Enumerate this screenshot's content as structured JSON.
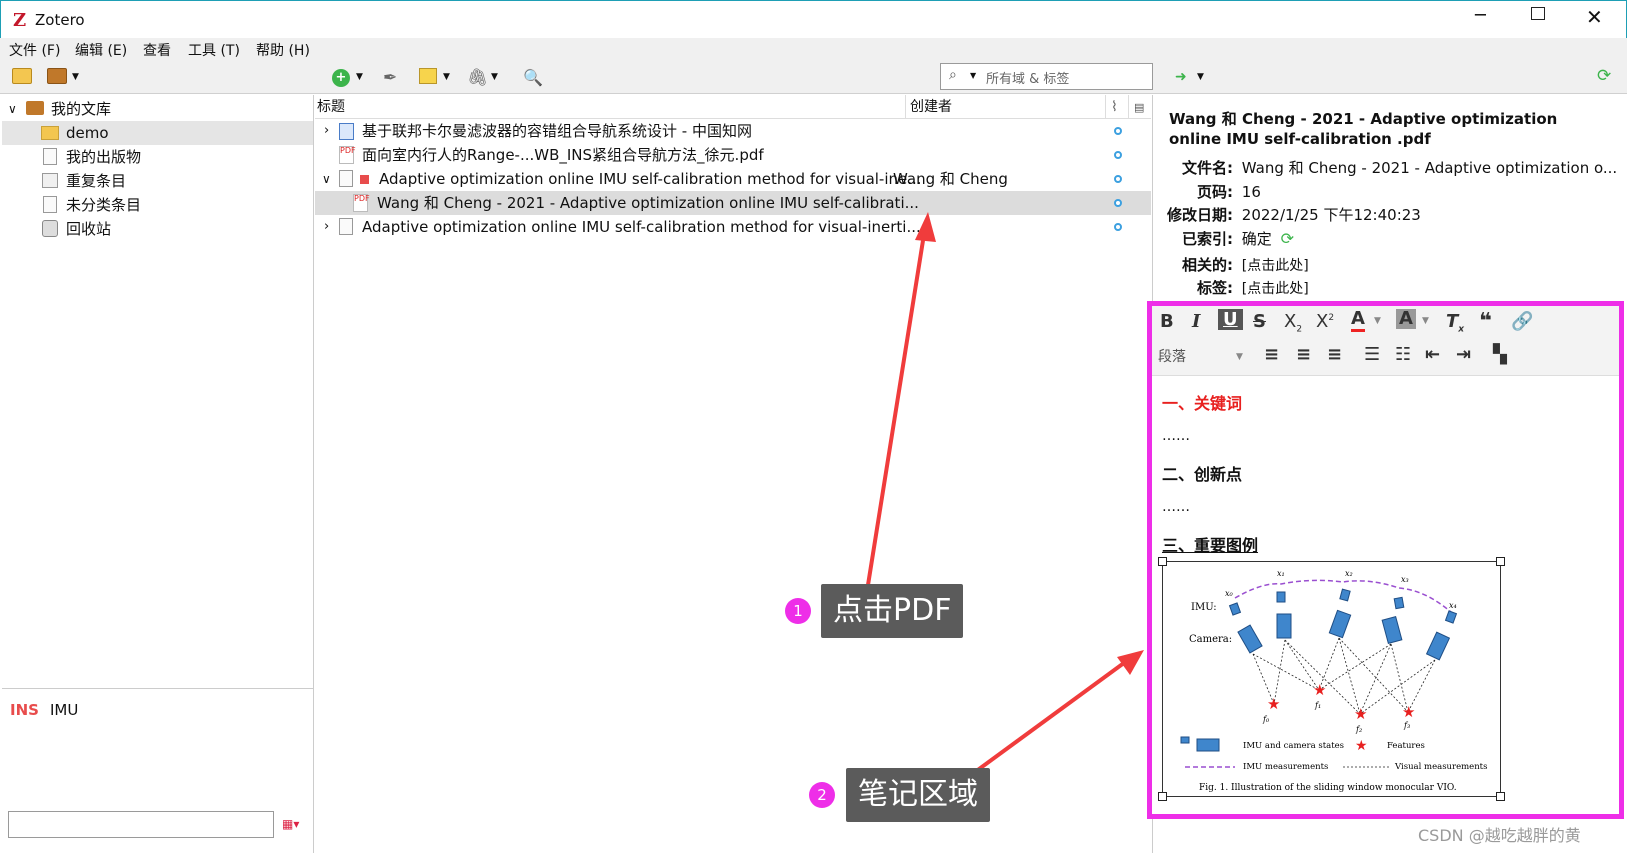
{
  "window": {
    "app_title": "Zotero"
  },
  "menu": [
    "文件 (F)",
    "编辑 (E)",
    "查看",
    "工具 (T)",
    "帮助 (H)"
  ],
  "search": {
    "placeholder": "所有域 & 标签"
  },
  "library": {
    "root": "我的文库",
    "items": [
      "demo",
      "我的出版物",
      "重复条目",
      "未分类条目",
      "回收站"
    ]
  },
  "tags": [
    "INS",
    "IMU"
  ],
  "columns": {
    "title": "标题",
    "creator": "创建者"
  },
  "items": [
    {
      "title": "基于联邦卡尔曼滤波器的容错组合导航系统设计 - 中国知网",
      "creator": ""
    },
    {
      "title": "面向室内行人的Range-...WB_INS紧组合导航方法_徐元.pdf",
      "creator": ""
    },
    {
      "title": "Adaptive optimization online IMU self-calibration method for visual-ine...",
      "creator": "Wang 和 Cheng"
    },
    {
      "title": "Wang 和 Cheng - 2021 - Adaptive optimization online IMU self-calibrati...",
      "creator": ""
    },
    {
      "title": "Adaptive optimization online IMU self-calibration method for visual-inerti...",
      "creator": ""
    }
  ],
  "details": {
    "heading": "Wang 和 Cheng - 2021 - Adaptive optimization online IMU self-calibration .pdf",
    "fields": [
      {
        "label": "文件名:",
        "value": "Wang 和 Cheng - 2021 - Adaptive optimization o..."
      },
      {
        "label": "页码:",
        "value": "16"
      },
      {
        "label": "修改日期:",
        "value": "2022/1/25 下午12:40:23"
      },
      {
        "label": "已索引:",
        "value": "确定"
      },
      {
        "label": "相关的:",
        "value": "[点击此处]"
      },
      {
        "label": "标签:",
        "value": "[点击此处]"
      }
    ]
  },
  "editor": {
    "paragraph_select": "段落",
    "h1": "一、关键词",
    "dots1": "……",
    "h2": "二、创新点",
    "dots2": "……",
    "h3": "三、重要图例",
    "figure": {
      "imu_label": "IMU:",
      "camera_label": "Camera:",
      "x_labels": [
        "x0",
        "x1",
        "x2",
        "x3",
        "x4"
      ],
      "f_labels": [
        "f0",
        "f1",
        "f2",
        "f3"
      ],
      "legend": [
        "IMU and camera states",
        "Features",
        "IMU measurements",
        "Visual measurements"
      ],
      "caption": "Fig. 1.  Illustration of the sliding window monocular VIO."
    }
  },
  "annotations": [
    {
      "num": "1",
      "text": "点击PDF"
    },
    {
      "num": "2",
      "text": "笔记区域"
    }
  ],
  "watermark": "CSDN @越吃越胖的黄",
  "colors": {
    "highlight": "#ee2ee8",
    "selected_row": "#dcdcdc",
    "arrow": "#f03c3c"
  }
}
